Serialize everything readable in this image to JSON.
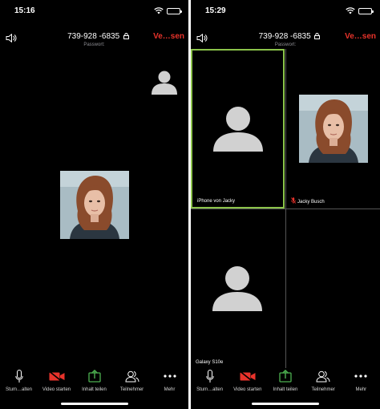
{
  "left_phone": {
    "time": "15:16",
    "meeting_id": "739-928 -6835",
    "password_label": "Passwort:",
    "leave_label": "Ve…sen",
    "toolbar": {
      "mute": "Stum…alten",
      "video": "Video starten",
      "share": "Inhalt teilen",
      "participants": "Teilnehmer",
      "more": "Mehr"
    }
  },
  "right_phone": {
    "time": "15:29",
    "meeting_id": "739-928 -6835",
    "password_label": "Passwort:",
    "leave_label": "Ve…sen",
    "tiles": [
      {
        "name": "iPhone von Jacky"
      },
      {
        "name": "Jacky Busch"
      },
      {
        "name": "Galaxy S10e"
      }
    ],
    "toolbar": {
      "mute": "Stum…alten",
      "video": "Video starten",
      "share": "Inhalt teilen",
      "participants": "Teilnehmer",
      "more": "Mehr"
    }
  },
  "colors": {
    "background": "#000000",
    "accent_leave": "#e8332b",
    "video_off_icon": "#e8332b",
    "share_icon": "#4caf50",
    "active_speaker_border": "#8bc34a",
    "mic_off_icon": "#e8332b",
    "placeholder_avatar": "#d1d1d1"
  },
  "icons": [
    "speaker-icon",
    "lock-icon",
    "wifi-icon",
    "battery-icon",
    "microphone-icon",
    "video-off-icon",
    "share-up-arrow-icon",
    "participants-icon",
    "more-dots-icon",
    "mic-off-icon",
    "person-placeholder-icon"
  ]
}
